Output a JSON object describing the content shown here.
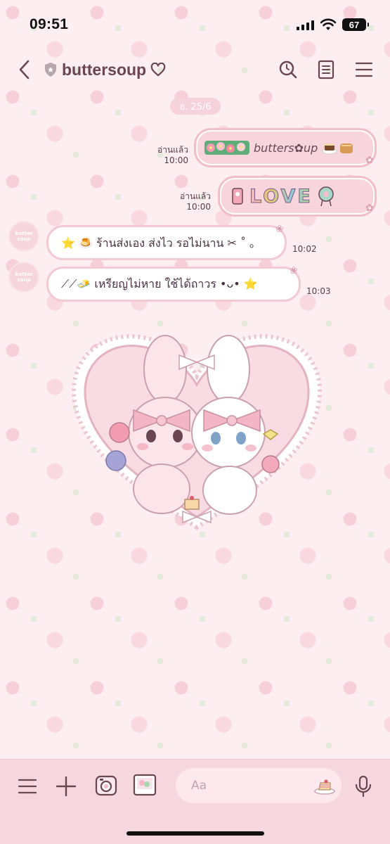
{
  "status": {
    "time": "09:51",
    "battery": "67"
  },
  "header": {
    "title": "buttersoup"
  },
  "date_chip": "อ. 25/6",
  "messages": [
    {
      "side": "out",
      "read": "อ่านแล้ว",
      "time": "10:00",
      "text": "butters✿up"
    },
    {
      "side": "out",
      "read": "อ่านแล้ว",
      "time": "10:00",
      "text": "LOVE"
    },
    {
      "side": "in",
      "time": "10:02",
      "text": "⭐ 🍮 ร้านส่งเอง ส่งไว รอไม่นาน ✂ ˚ ｡"
    },
    {
      "side": "in",
      "time": "10:03",
      "text": "⟋⟋🧈 เหรียญไม่หาย ใช้ได้ถาวร •ᴗ• ⭐"
    }
  ],
  "avatar_text": "butter soup",
  "input": {
    "placeholder": "Aa"
  },
  "colors": {
    "bar": "#f6d6df",
    "bubble_out": "#f8d4dc",
    "bubble_in": "#ffffff",
    "accent": "#6a4552"
  }
}
